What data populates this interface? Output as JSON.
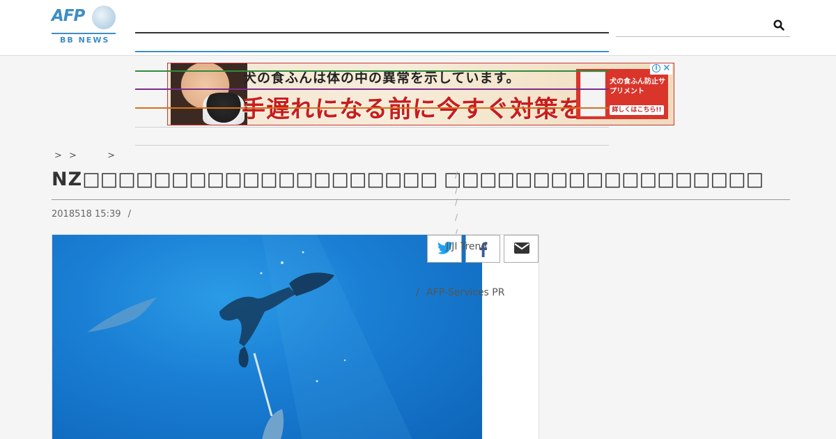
{
  "header": {
    "logo_main": "AFP",
    "logo_sub": "BB NEWS",
    "search": {
      "placeholder": "",
      "value": ""
    }
  },
  "ad": {
    "headline_top": "犬の食ふんは体の中の異常を示しています。",
    "headline_main": "手遅れになる前に今すぐ対策を!",
    "product_text": "犬の食ふん防止サプリメント",
    "cta_label": "詳しくはこちら!!",
    "info_label": "i",
    "close_label": "✕"
  },
  "breadcrumb": {
    "sep1": ">",
    "sep2": ">",
    "sep3": ">"
  },
  "article": {
    "title": "NZ",
    "date": "2018518 15:39",
    "date_sep": "/"
  },
  "side_links": {
    "jiji": "JIJI Trend",
    "afp_services": "AFP-Services PR",
    "slash": "/"
  },
  "share": {
    "twitter": "twitter-icon",
    "facebook": "facebook-icon",
    "mail": "mail-icon"
  },
  "colors": {
    "brand_blue": "#3e8ec4",
    "menu_green": "#2e8b3a",
    "menu_purple": "#7a2e8a",
    "menu_orange": "#d6701c"
  }
}
